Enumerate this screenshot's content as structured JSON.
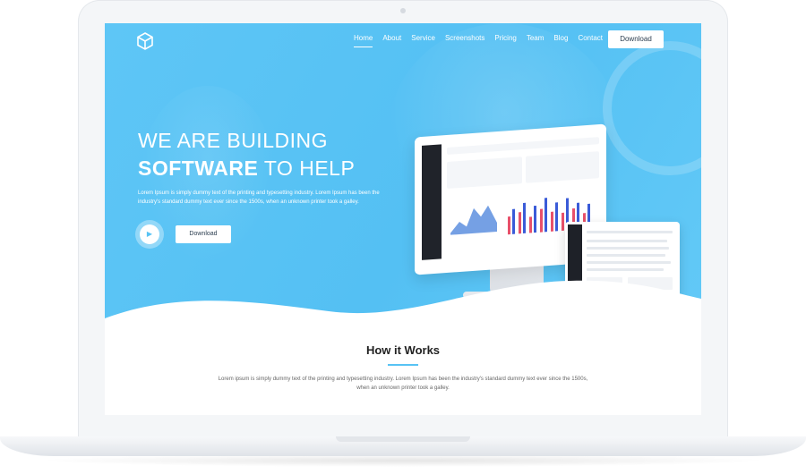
{
  "nav": {
    "items": [
      "Home",
      "About",
      "Service",
      "Screenshots",
      "Pricing",
      "Team",
      "Blog",
      "Contact"
    ],
    "active": "Home",
    "download_label": "Download"
  },
  "hero": {
    "headline_line1": "WE ARE BUILDING",
    "headline_line2_bold": "SOFTWARE",
    "headline_line2_rest": " TO HELP",
    "description": "Lorem Ipsum is simply dummy text of the printing and typesetting industry. Lorem Ipsum has been the industry's standard dummy text ever since the 1500s, when an unknown printer took a galley.",
    "play_icon": "▶",
    "download_label": "Download"
  },
  "how_it_works": {
    "title": "How it Works",
    "description": "Lorem ipsum is simply dummy text of the printing and typesetting industry. Lorem Ipsum has been the industry's standard dummy text ever since the 1500s, when an unknown printer took a galley."
  },
  "colors": {
    "accent": "#58c3f4",
    "hero_bg": "#54c0f3",
    "text_dark": "#222222"
  }
}
